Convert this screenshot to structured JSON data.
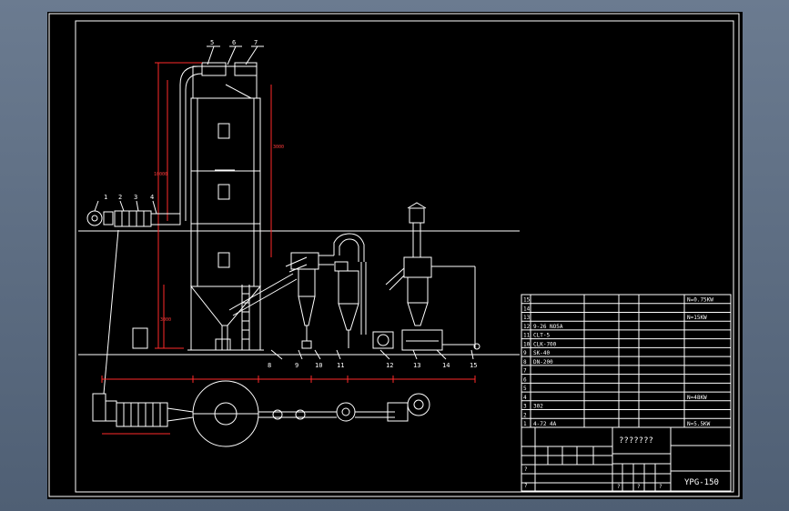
{
  "drawing": {
    "title_block": {
      "name": "???????",
      "code": "YPG-150"
    },
    "part_numbers": [
      "1",
      "2",
      "3",
      "4",
      "5",
      "6",
      "7",
      "8",
      "9",
      "10",
      "11",
      "12",
      "13",
      "14",
      "15"
    ],
    "bom_rows": [
      {
        "no": "15",
        "model": "",
        "spec": "",
        "qty": "",
        "note": "N=0.75KW"
      },
      {
        "no": "14",
        "model": "",
        "spec": "",
        "qty": "",
        "note": ""
      },
      {
        "no": "13",
        "model": "",
        "spec": "",
        "qty": "",
        "note": "N=15KW"
      },
      {
        "no": "12",
        "model": "9-26 NO5A",
        "spec": "",
        "qty": "",
        "note": ""
      },
      {
        "no": "11",
        "model": "CLT-5",
        "spec": "",
        "qty": "",
        "note": ""
      },
      {
        "no": "10",
        "model": "CLK-700",
        "spec": "",
        "qty": "",
        "note": ""
      },
      {
        "no": "9",
        "model": "SK-40",
        "spec": "",
        "qty": "",
        "note": ""
      },
      {
        "no": "8",
        "model": "DN-200",
        "spec": "",
        "qty": "",
        "note": ""
      },
      {
        "no": "7",
        "model": "",
        "spec": "",
        "qty": "",
        "note": ""
      },
      {
        "no": "6",
        "model": "",
        "spec": "",
        "qty": "",
        "note": ""
      },
      {
        "no": "5",
        "model": "",
        "spec": "",
        "qty": "",
        "note": ""
      },
      {
        "no": "4",
        "model": "",
        "spec": "",
        "qty": "",
        "note": "N=48KW"
      },
      {
        "no": "3",
        "model": "302",
        "spec": "",
        "qty": "",
        "note": ""
      },
      {
        "no": "2",
        "model": "",
        "spec": "",
        "qty": "",
        "note": ""
      },
      {
        "no": "1",
        "model": "4-72 4A",
        "spec": "",
        "qty": "",
        "note": "N=5.5KW"
      }
    ],
    "marks": [
      "?",
      "?",
      "?",
      "?",
      "?"
    ]
  }
}
